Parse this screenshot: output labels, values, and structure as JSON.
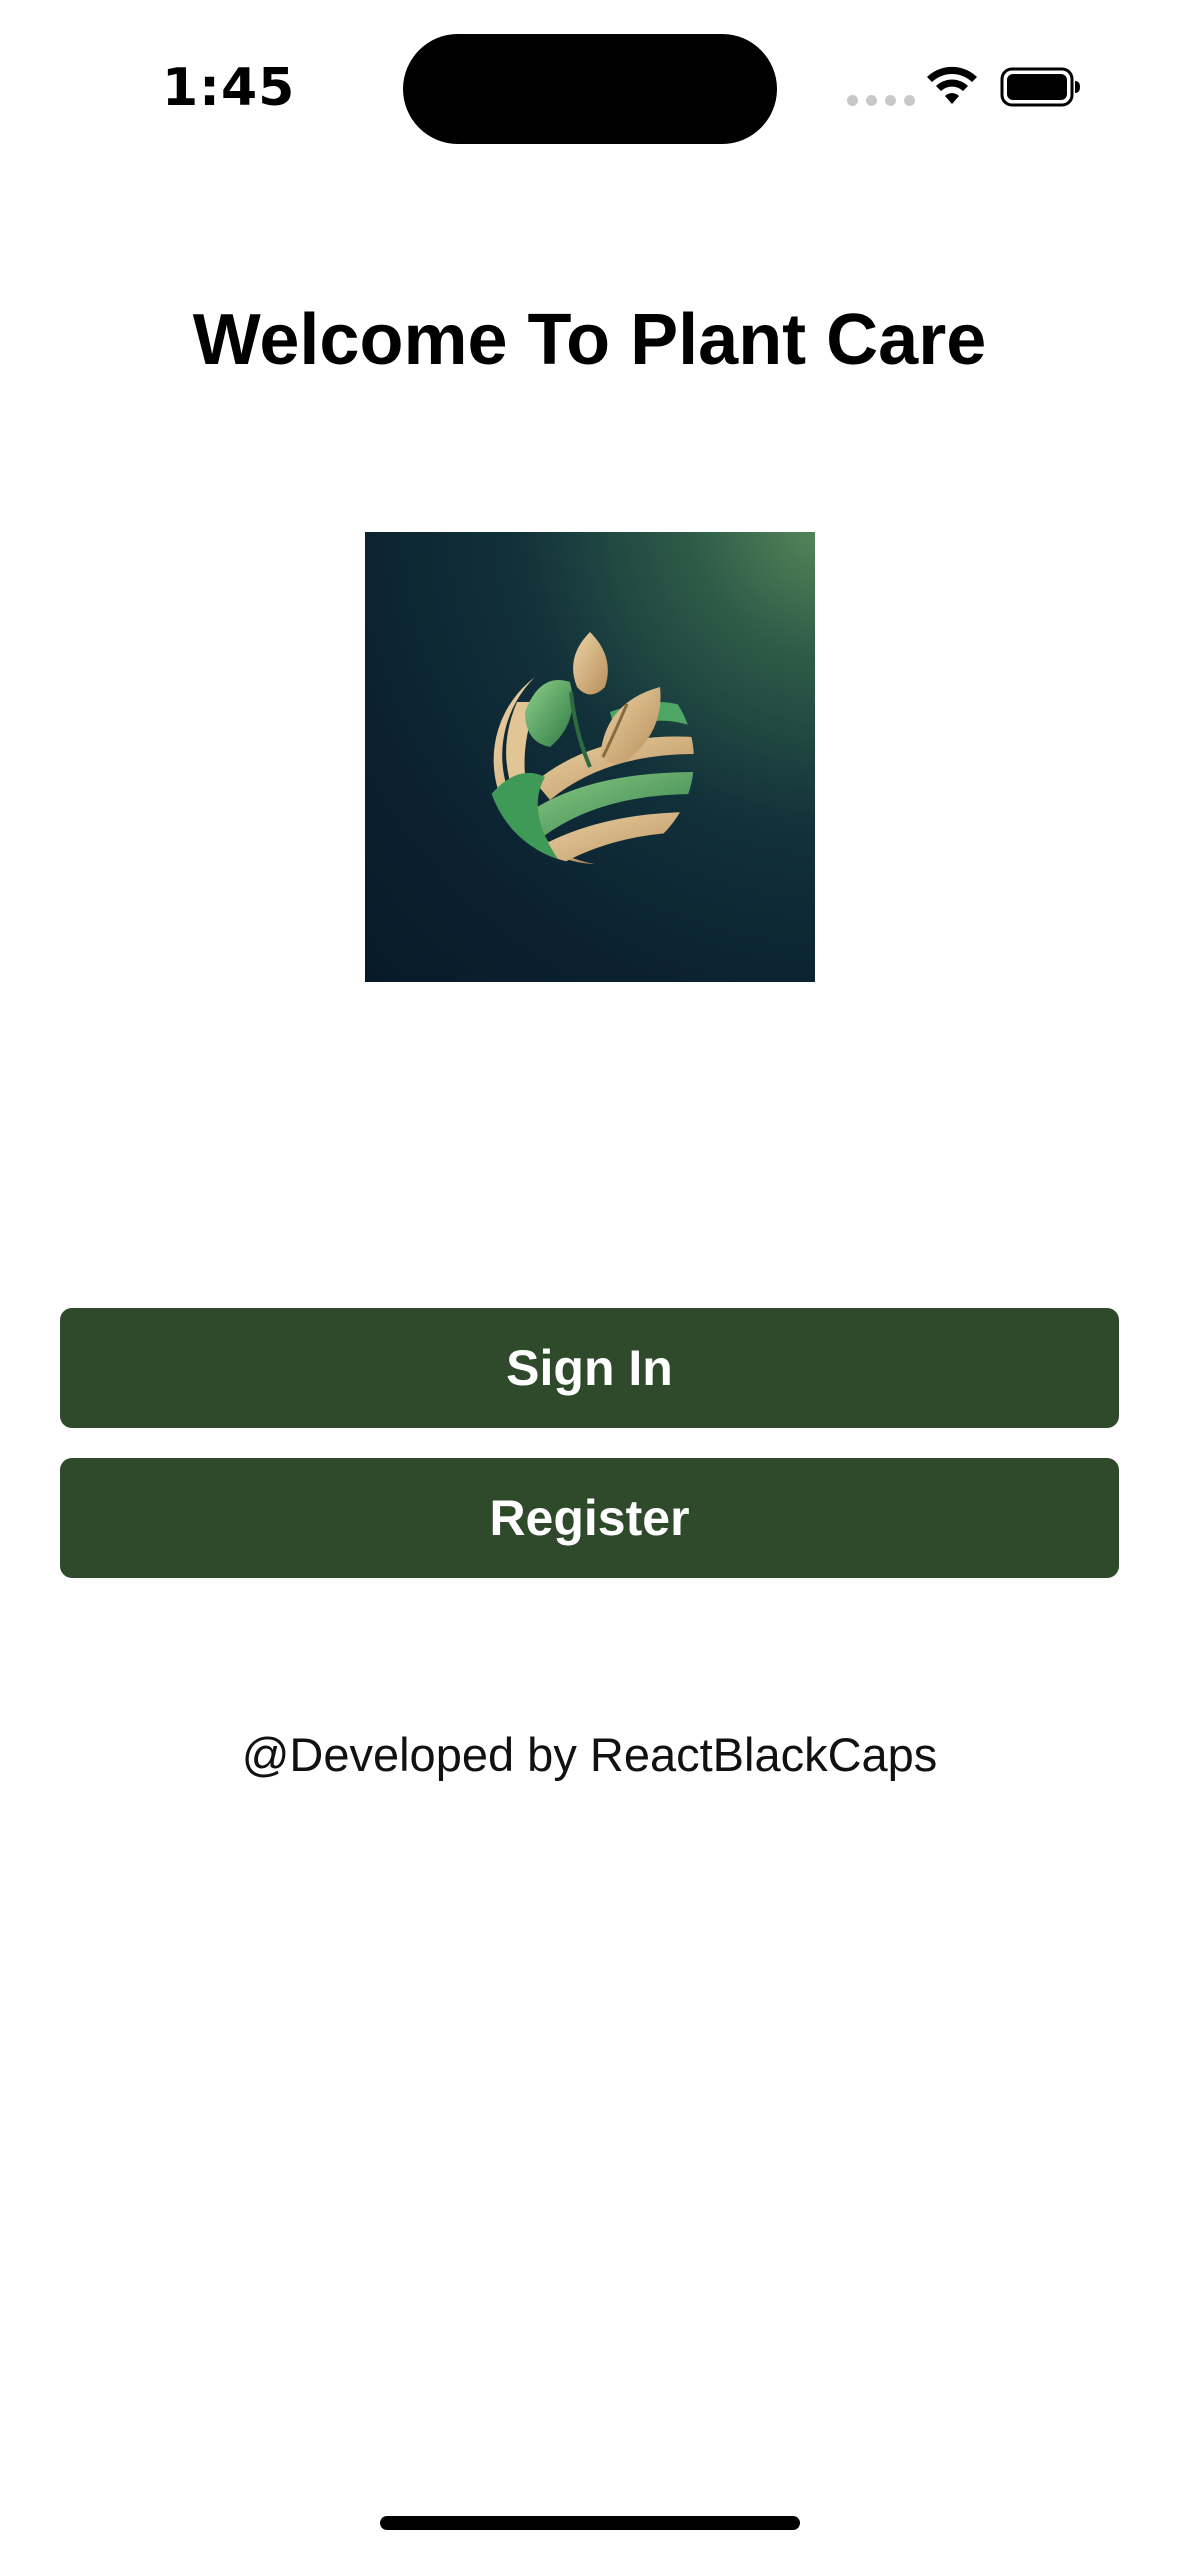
{
  "status_bar": {
    "time": "1:45",
    "icons": [
      "signal-dots-icon",
      "wifi-icon",
      "battery-icon"
    ]
  },
  "page": {
    "title": "Welcome To Plant Care"
  },
  "logo": {
    "icon": "plant-leaf-logo-icon",
    "colors": {
      "background": "#0b2130",
      "leaf_green": "#5faa6a",
      "leaf_gold": "#d8b889"
    }
  },
  "actions": {
    "sign_in_label": "Sign In",
    "register_label": "Register",
    "button_color": "#2e4a2b"
  },
  "footer": {
    "credit": "@Developed by ReactBlackCaps"
  }
}
